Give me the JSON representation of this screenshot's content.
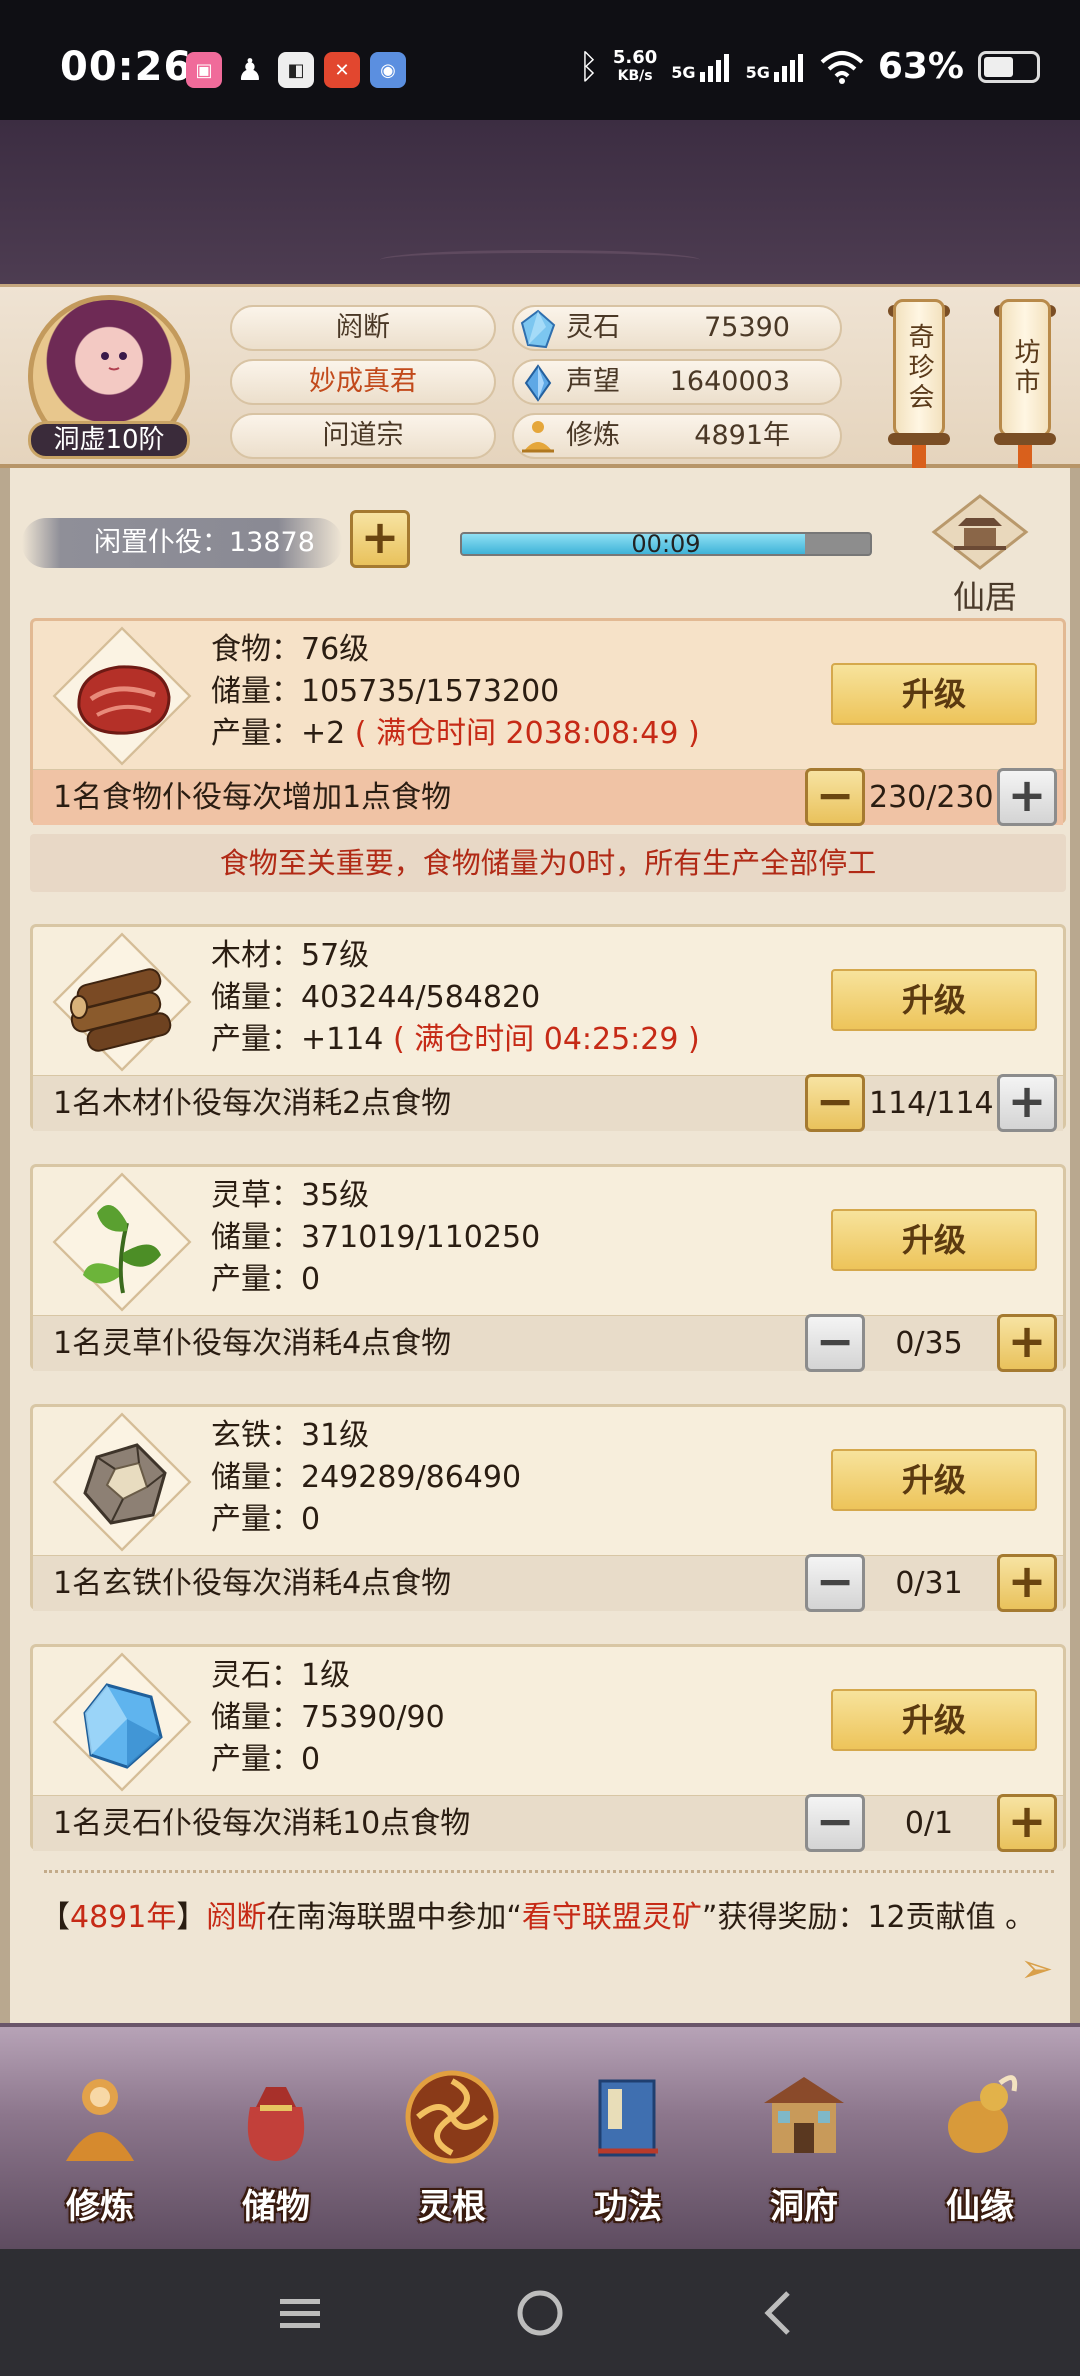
{
  "status_bar": {
    "time": "00:26",
    "net_speed_value": "5.60",
    "net_speed_unit": "KB/s",
    "sim1": "5G",
    "sim2": "5G",
    "battery": "63%",
    "battery_level": 0.63
  },
  "header": {
    "realm": "洞虚10阶",
    "name": "阏断",
    "title": "妙成真君",
    "sect": "问道宗",
    "resources": [
      {
        "label": "灵石",
        "value": "75390",
        "icon": "spirit-stone-icon"
      },
      {
        "label": "声望",
        "value": "1640003",
        "icon": "reputation-icon"
      },
      {
        "label": "修炼",
        "value": "4891年",
        "icon": "meditation-icon"
      }
    ],
    "shop_button": "奇珍会",
    "market_button": "坊市"
  },
  "idle": {
    "label": "闲置仆役：13878",
    "timer": "00:09",
    "timer_progress": 0.84,
    "residence_label": "仙居"
  },
  "cards": [
    {
      "level": "食物：76级",
      "storage": "储量：105735/1573200",
      "output_prefix": "产量：+2",
      "output_full": "( 满仓时间 2038:08:49 )",
      "upgrade": "升级",
      "desc": "1名食物仆役每次增加1点食物",
      "count": "230/230",
      "icon": "meat-icon"
    },
    {
      "level": "木材：57级",
      "storage": "储量：403244/584820",
      "output_prefix": "产量：+114",
      "output_full": "( 满仓时间 04:25:29 )",
      "upgrade": "升级",
      "desc": "1名木材仆役每次消耗2点食物",
      "count": "114/114",
      "icon": "wood-icon"
    },
    {
      "level": "灵草：35级",
      "storage": "储量：371019/110250",
      "output_prefix": "产量：0",
      "output_full": "",
      "upgrade": "升级",
      "desc": "1名灵草仆役每次消耗4点食物",
      "count": "0/35",
      "icon": "herb-icon"
    },
    {
      "level": "玄铁：31级",
      "storage": "储量：249289/86490",
      "output_prefix": "产量：0",
      "output_full": "",
      "upgrade": "升级",
      "desc": "1名玄铁仆役每次消耗4点食物",
      "count": "0/31",
      "icon": "ore-icon"
    },
    {
      "level": "灵石：1级",
      "storage": "储量：75390/90",
      "output_prefix": "产量：0",
      "output_full": "",
      "upgrade": "升级",
      "desc": "1名灵石仆役每次消耗10点食物",
      "count": "0/1",
      "icon": "crystal-icon"
    }
  ],
  "warning": "食物至关重要，食物储量为0时，所有生产全部停工",
  "log": {
    "open": "【",
    "year": "4891年",
    "close": "】",
    "actor": "阏断",
    "mid": "在南海联盟中参加",
    "quote_open": "“",
    "event": "看守联盟灵矿",
    "quote_close": "”",
    "tail": "获得奖励：12贡献值 。"
  },
  "nav": [
    {
      "label": "修炼",
      "icon": "cultivate-icon"
    },
    {
      "label": "储物",
      "icon": "storage-bag-icon"
    },
    {
      "label": "灵根",
      "icon": "spirit-root-icon"
    },
    {
      "label": "功法",
      "icon": "scripture-icon"
    },
    {
      "label": "洞府",
      "icon": "cave-dwelling-icon"
    },
    {
      "label": "仙缘",
      "icon": "fortune-icon"
    }
  ],
  "colors": {
    "accent_red": "#c62a16",
    "gold_button": "#edc45a",
    "panel": "#efe5d4"
  }
}
